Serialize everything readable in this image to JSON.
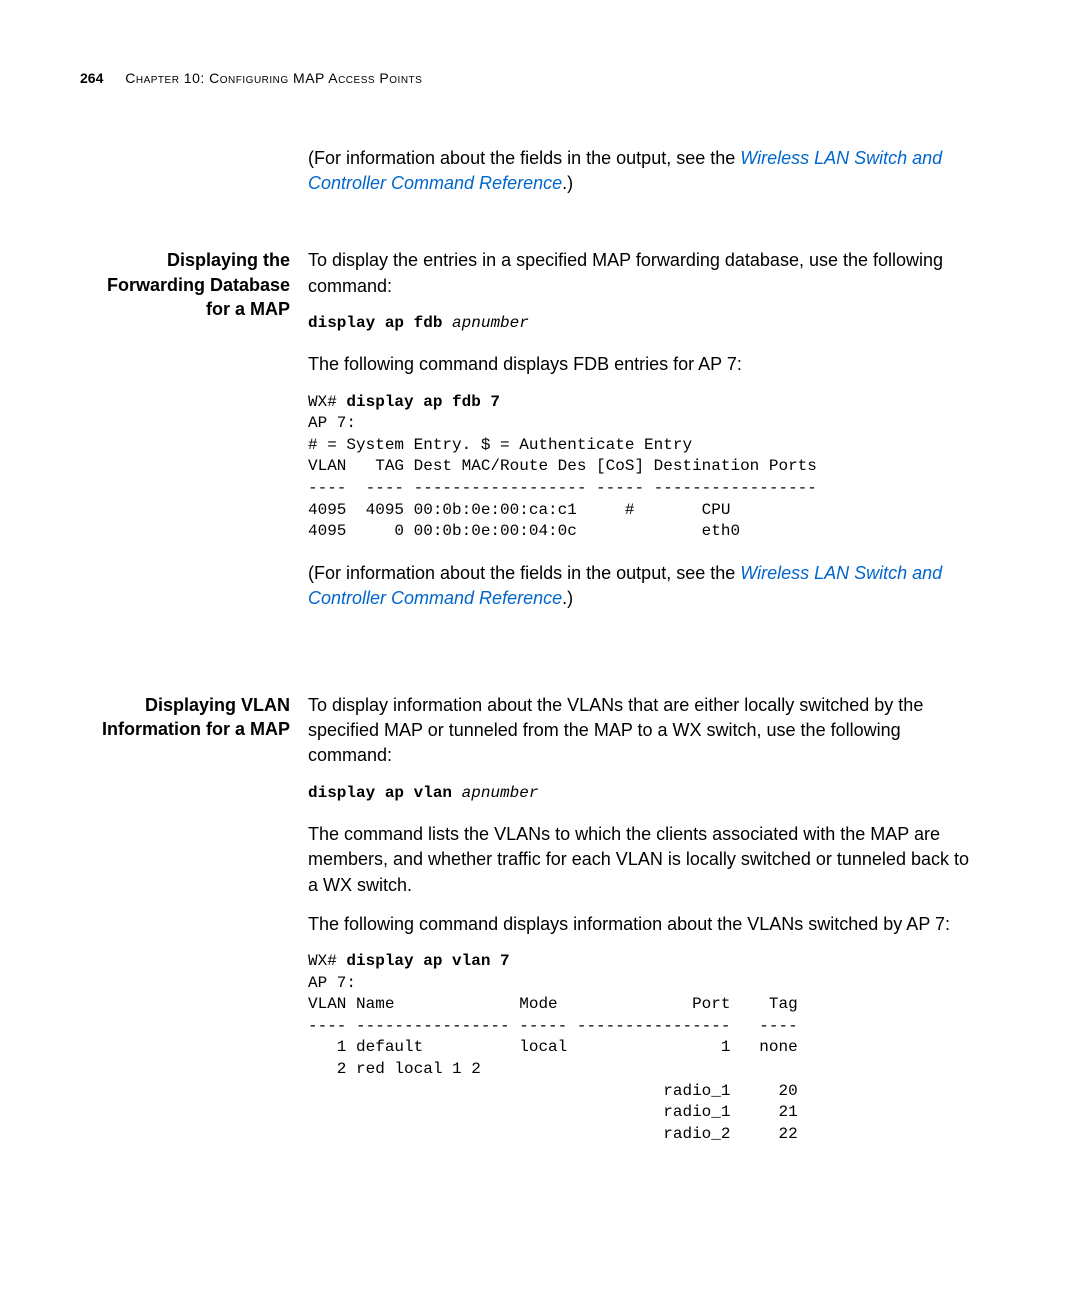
{
  "header": {
    "page_number": "264",
    "chapter": "Chapter 10: Configuring MAP Access Points"
  },
  "section0": {
    "ref_intro": "(For information about the fields in the output, see the ",
    "ref_link": "Wireless LAN Switch and Controller Command Reference",
    "ref_close": ".)"
  },
  "section1": {
    "title": "Displaying the Forwarding Database for a MAP",
    "intro": "To display the entries in a specified MAP forwarding database, use the following command:",
    "cmd_bold": "display ap fdb ",
    "cmd_arg": "apnumber",
    "desc": "The following command displays FDB entries for AP 7:",
    "out_prompt": "WX# ",
    "out_cmd": "display ap fdb 7",
    "out_body": "AP 7:\n# = System Entry. $ = Authenticate Entry\nVLAN   TAG Dest MAC/Route Des [CoS] Destination Ports\n----  ---- ------------------ ----- -----------------\n4095  4095 00:0b:0e:00:ca:c1     #       CPU\n4095     0 00:0b:0e:00:04:0c             eth0",
    "ref_intro": "(For information about the fields in the output, see the ",
    "ref_link": "Wireless LAN Switch and Controller Command Reference",
    "ref_close": ".)"
  },
  "section2": {
    "title": "Displaying VLAN Information for a MAP",
    "intro": "To display information about the VLANs that are either locally switched by the specified MAP or tunneled from the MAP to a WX switch, use the following command:",
    "cmd_bold": "display ap vlan ",
    "cmd_arg": "apnumber",
    "desc1": "The command lists the VLANs to which the clients associated with the MAP are members, and whether traffic for each VLAN is locally switched or tunneled back to a WX switch.",
    "desc2": "The following command displays information about the VLANs switched by AP 7:",
    "out_prompt": "WX# ",
    "out_cmd": "display ap vlan 7",
    "out_body": "AP 7:\nVLAN Name             Mode              Port    Tag\n---- ---------------- ----- ----------------   ----\n   1 default          local                1   none\n   2 red local 1 2\n                                     radio_1     20\n                                     radio_1     21\n                                     radio_2     22"
  }
}
